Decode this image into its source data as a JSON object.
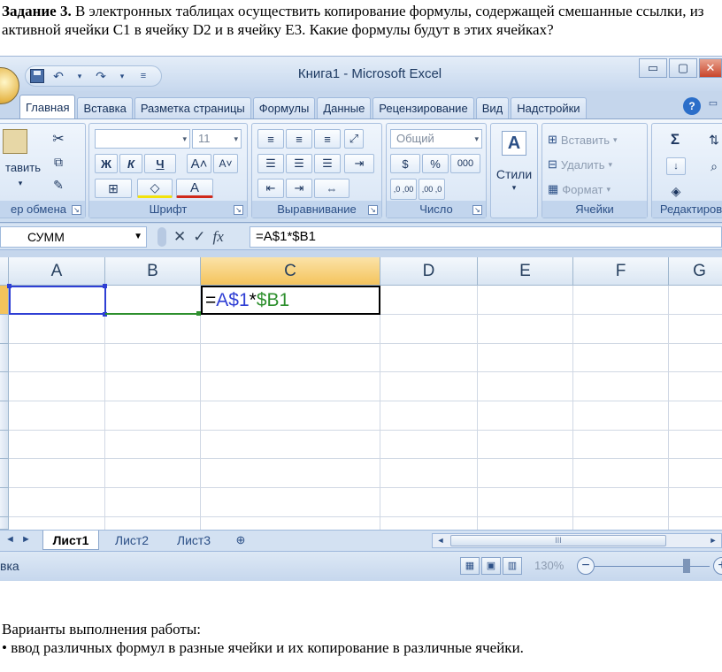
{
  "task": {
    "heading": "Задание 3.",
    "text": " В электронных таблицах осуществить копирование формулы, содержащей смешанные ссылки, из активной ячейки C1 в ячейку D2 и в ячейку E3. Какие формулы будут в этих ячейках?"
  },
  "window": {
    "title": "Книга1 - Microsoft Excel",
    "controls": {
      "minimize": "▭",
      "restore": "▢",
      "close": "✕"
    }
  },
  "ribbon": {
    "tabs": [
      "Главная",
      "Вставка",
      "Разметка страницы",
      "Формулы",
      "Данные",
      "Рецензирование",
      "Вид",
      "Надстройки"
    ],
    "help_icon": "?",
    "groups": {
      "clipboard": {
        "label": "ер обмена",
        "paste": "тавить"
      },
      "font": {
        "label": "Шрифт",
        "size": "11",
        "bold": "Ж",
        "italic": "К",
        "underline": "Ч",
        "grow": "A˄",
        "shrink": "A˅"
      },
      "alignment": {
        "label": "Выравнивание"
      },
      "number": {
        "label": "Число",
        "format": "Общий",
        "percent": "%",
        "thousands": "000",
        "inc_decimal": ",0 ,00",
        "dec_decimal": ",00 ,0"
      },
      "styles": {
        "label": "Стили",
        "icon": "A"
      },
      "cells": {
        "label": "Ячейки",
        "insert": "Вставить",
        "delete": "Удалить",
        "format": "Формат"
      },
      "editing": {
        "label": "Редактиров",
        "sigma": "Σ"
      }
    }
  },
  "formula_bar": {
    "name_box": "СУММ",
    "cancel": "✕",
    "enter": "✓",
    "fx": "fx",
    "formula": "=A$1*$B1"
  },
  "grid": {
    "columns": [
      "A",
      "B",
      "C",
      "D",
      "E",
      "F",
      "G"
    ],
    "active_cell_text": {
      "eq": "=",
      "ref1": "A$1",
      "op": "*",
      "ref2": "$B1"
    }
  },
  "sheets": {
    "nav": "◄ ►",
    "tabs": [
      "Лист1",
      "Лист2",
      "Лист3"
    ],
    "active": "Лист1",
    "scroll_grip": "III"
  },
  "status_bar": {
    "mode": "вка",
    "zoom": "130%",
    "minus": "−",
    "plus": "+"
  },
  "variants": {
    "heading": "Варианты выполнения работы:",
    "item": "• ввод различных формул в разные ячейки и их копирование в различные ячейки."
  },
  "colors": {
    "ref1": "#2f3fd4",
    "ref2": "#2d8f2d",
    "selected_header": "#f4c35c"
  }
}
